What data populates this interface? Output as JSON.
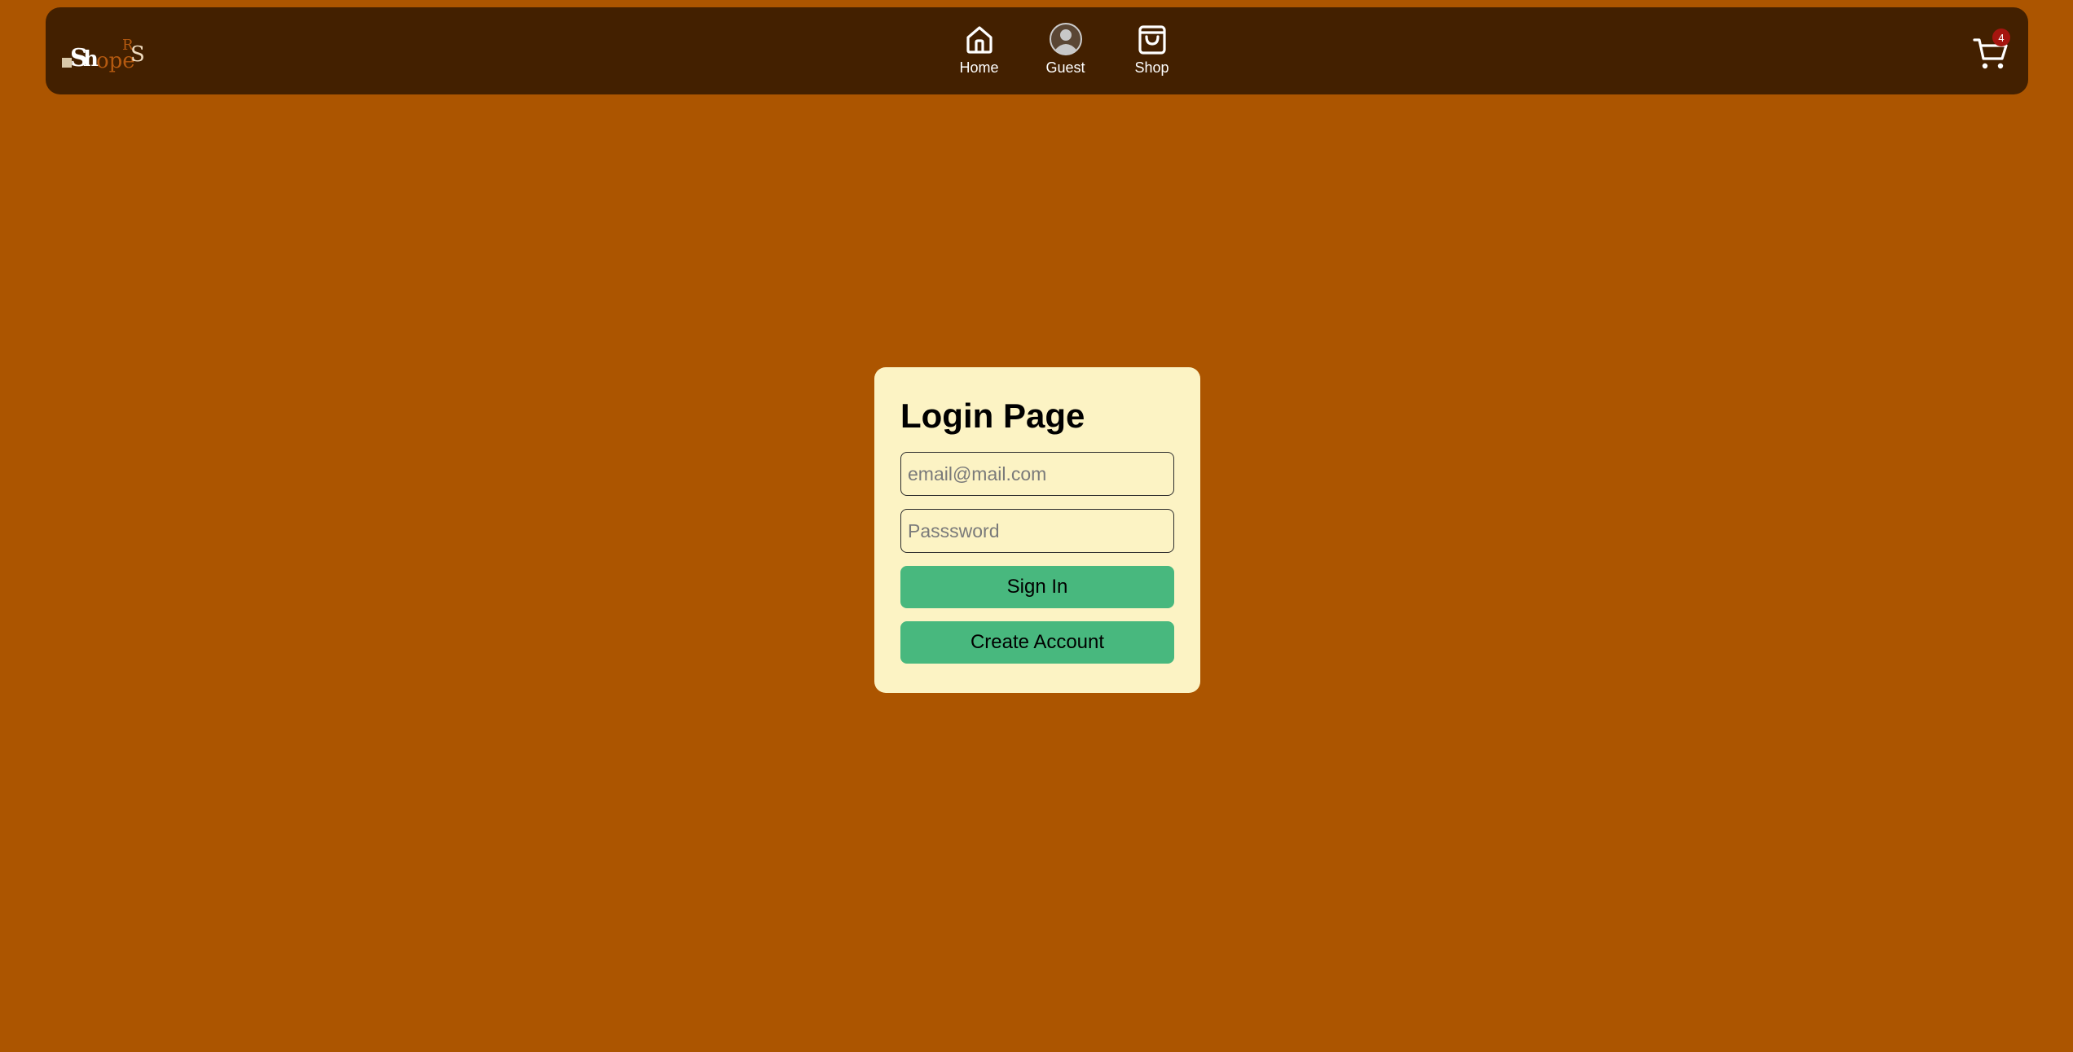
{
  "app": {
    "logo_text": "ShopeRS"
  },
  "navbar": {
    "items": [
      {
        "label": "Home",
        "icon": "home-icon"
      },
      {
        "label": "Guest",
        "icon": "avatar-icon"
      },
      {
        "label": "Shop",
        "icon": "shopping-bag-icon"
      }
    ],
    "cart": {
      "icon": "cart-icon",
      "count": "4"
    }
  },
  "login": {
    "title": "Login Page",
    "email_placeholder": "email@mail.com",
    "email_value": "",
    "password_placeholder": "Passsword",
    "password_value": "",
    "sign_in_label": "Sign In",
    "create_account_label": "Create Account"
  },
  "colors": {
    "background": "#ac5500",
    "navbar": "#432000",
    "card": "#fcf3c4",
    "button": "#48b87e",
    "badge": "#a5150f"
  }
}
